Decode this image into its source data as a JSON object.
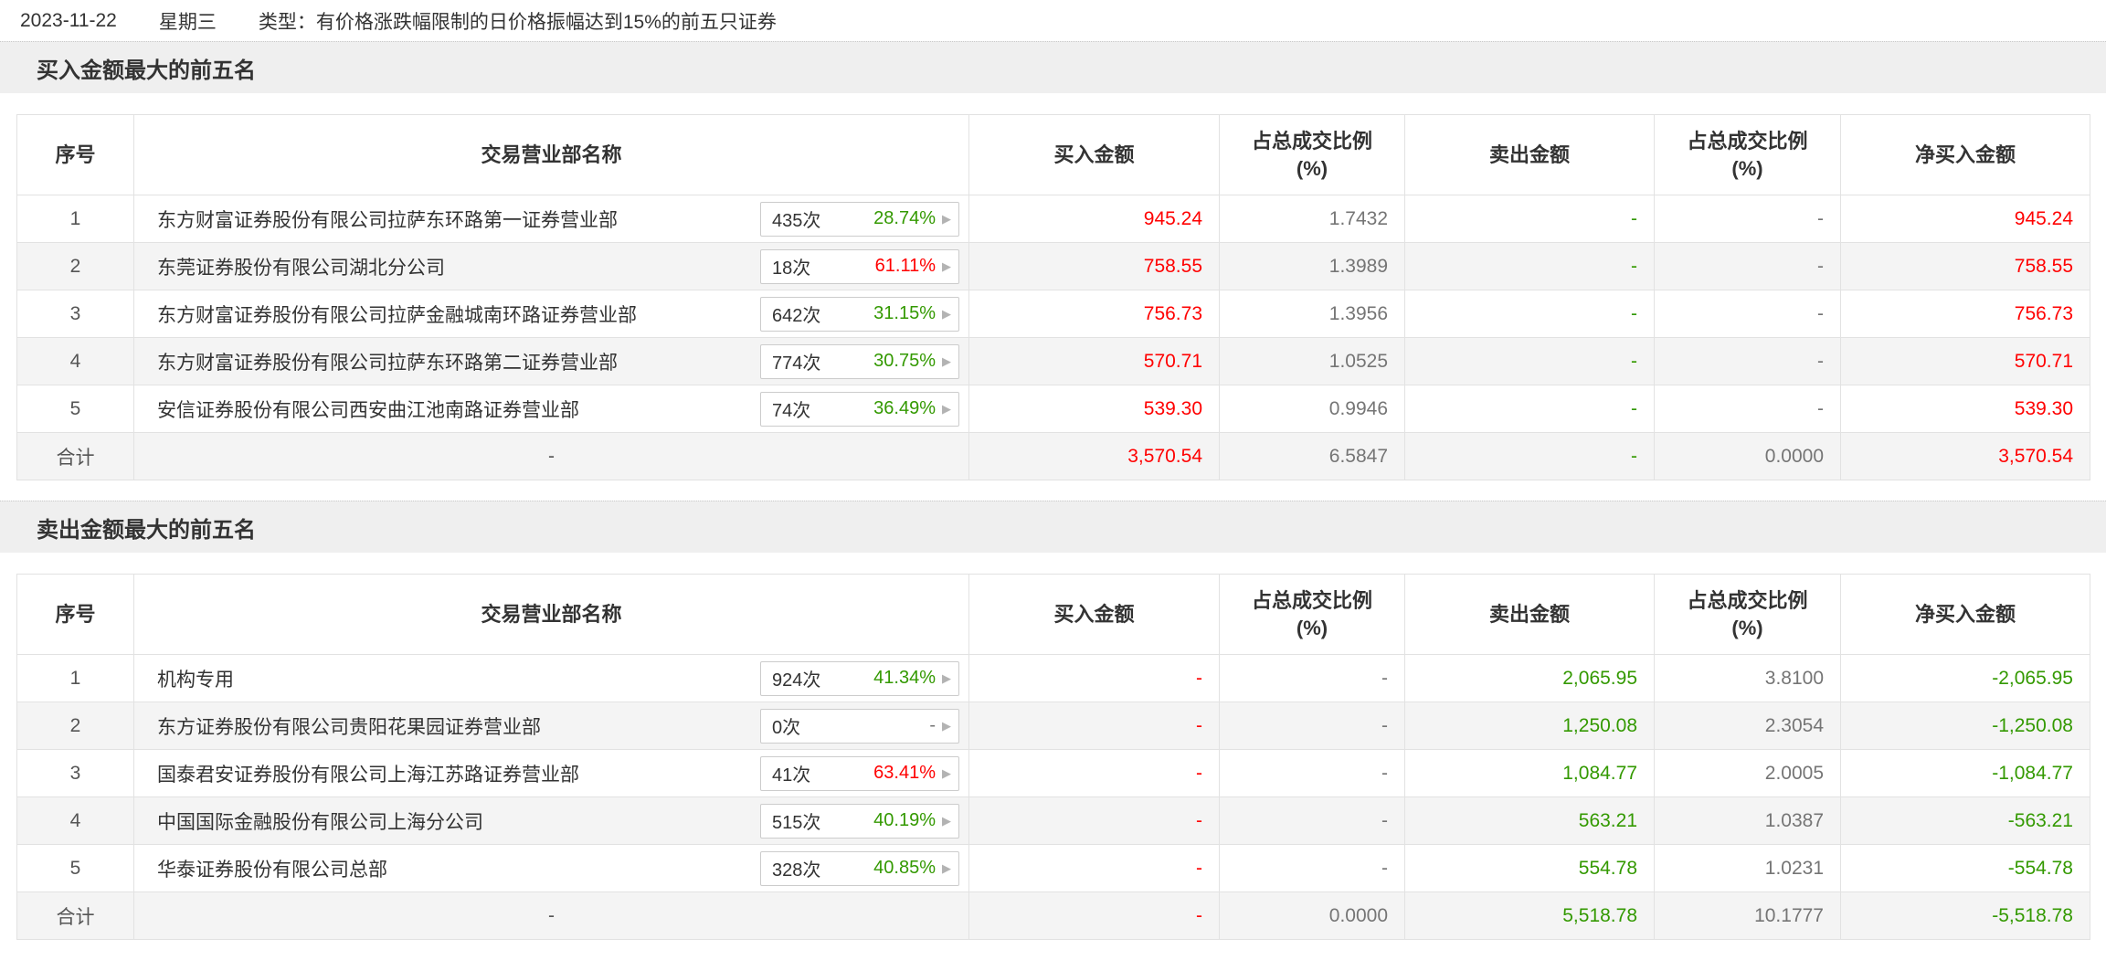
{
  "colors": {
    "up_red": "#ff0000",
    "down_green": "#339900",
    "ratio_gray": "#757575"
  },
  "header": {
    "date": "2023-11-22",
    "weekday": "星期三",
    "type_text": "类型：有价格涨跌幅限制的日价格振幅达到15%的前五只证券"
  },
  "columns": {
    "no": "序号",
    "name": "交易营业部名称",
    "buy": "买入金额",
    "ratio_line1": "占总成交比例",
    "ratio_line2": "(%)",
    "sell": "卖出金额",
    "net": "净买入金额"
  },
  "badge_arrow": "▶",
  "buy_table": {
    "title": "买入金额最大的前五名",
    "rows": [
      {
        "no": "1",
        "name": "东方财富证券股份有限公司拉萨东环路第一证券营业部",
        "times": "435次",
        "pct": "28.74%",
        "pct_color": "green",
        "buy": "945.24",
        "buy_ratio": "1.7432",
        "sell": "-",
        "sell_ratio": "-",
        "net": "945.24",
        "net_color": "red"
      },
      {
        "no": "2",
        "name": "东莞证券股份有限公司湖北分公司",
        "times": "18次",
        "pct": "61.11%",
        "pct_color": "red",
        "buy": "758.55",
        "buy_ratio": "1.3989",
        "sell": "-",
        "sell_ratio": "-",
        "net": "758.55",
        "net_color": "red"
      },
      {
        "no": "3",
        "name": "东方财富证券股份有限公司拉萨金融城南环路证券营业部",
        "times": "642次",
        "pct": "31.15%",
        "pct_color": "green",
        "buy": "756.73",
        "buy_ratio": "1.3956",
        "sell": "-",
        "sell_ratio": "-",
        "net": "756.73",
        "net_color": "red"
      },
      {
        "no": "4",
        "name": "东方财富证券股份有限公司拉萨东环路第二证券营业部",
        "times": "774次",
        "pct": "30.75%",
        "pct_color": "green",
        "buy": "570.71",
        "buy_ratio": "1.0525",
        "sell": "-",
        "sell_ratio": "-",
        "net": "570.71",
        "net_color": "red"
      },
      {
        "no": "5",
        "name": "安信证券股份有限公司西安曲江池南路证券营业部",
        "times": "74次",
        "pct": "36.49%",
        "pct_color": "green",
        "buy": "539.30",
        "buy_ratio": "0.9946",
        "sell": "-",
        "sell_ratio": "-",
        "net": "539.30",
        "net_color": "red"
      }
    ],
    "total": {
      "no": "合计",
      "name": "-",
      "buy": "3,570.54",
      "buy_ratio": "6.5847",
      "sell": "-",
      "sell_ratio": "0.0000",
      "net": "3,570.54",
      "net_color": "red"
    }
  },
  "sell_table": {
    "title": "卖出金额最大的前五名",
    "rows": [
      {
        "no": "1",
        "name": "机构专用",
        "times": "924次",
        "pct": "41.34%",
        "pct_color": "green",
        "buy": "-",
        "buy_ratio": "-",
        "sell": "2,065.95",
        "sell_ratio": "3.8100",
        "net": "-2,065.95",
        "net_color": "green"
      },
      {
        "no": "2",
        "name": "东方证券股份有限公司贵阳花果园证券营业部",
        "times": "0次",
        "pct": "-",
        "pct_color": "gray",
        "buy": "-",
        "buy_ratio": "-",
        "sell": "1,250.08",
        "sell_ratio": "2.3054",
        "net": "-1,250.08",
        "net_color": "green"
      },
      {
        "no": "3",
        "name": "国泰君安证券股份有限公司上海江苏路证券营业部",
        "times": "41次",
        "pct": "63.41%",
        "pct_color": "red",
        "buy": "-",
        "buy_ratio": "-",
        "sell": "1,084.77",
        "sell_ratio": "2.0005",
        "net": "-1,084.77",
        "net_color": "green"
      },
      {
        "no": "4",
        "name": "中国国际金融股份有限公司上海分公司",
        "times": "515次",
        "pct": "40.19%",
        "pct_color": "green",
        "buy": "-",
        "buy_ratio": "-",
        "sell": "563.21",
        "sell_ratio": "1.0387",
        "net": "-563.21",
        "net_color": "green"
      },
      {
        "no": "5",
        "name": "华泰证券股份有限公司总部",
        "times": "328次",
        "pct": "40.85%",
        "pct_color": "green",
        "buy": "-",
        "buy_ratio": "-",
        "sell": "554.78",
        "sell_ratio": "1.0231",
        "net": "-554.78",
        "net_color": "green"
      }
    ],
    "total": {
      "no": "合计",
      "name": "-",
      "buy": "-",
      "buy_ratio": "0.0000",
      "sell": "5,518.78",
      "sell_ratio": "10.1777",
      "net": "-5,518.78",
      "net_color": "green"
    }
  }
}
